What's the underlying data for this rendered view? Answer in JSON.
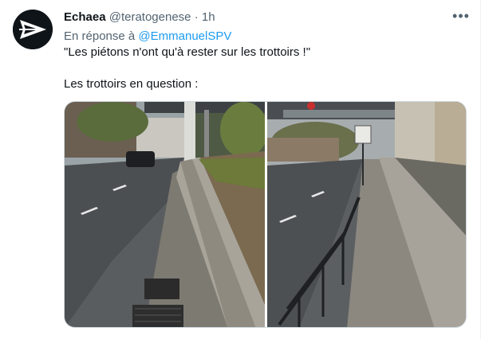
{
  "tweet": {
    "author_name": "Echaea",
    "author_handle": "@teratogenese",
    "separator": "·",
    "time": "1h",
    "more_label": "•••",
    "reply_prefix": "En réponse à",
    "reply_mention": "@EmmanuelSPV",
    "text_line1": "\"Les piétons n'ont qu'à rester sur les trottoirs !\"",
    "text_line2": "Les trottoirs en question :"
  },
  "icons": {
    "avatar": "arrow-logo-icon",
    "more": "more-horizontal-icon"
  },
  "colors": {
    "text": "#0f1419",
    "secondary": "#536471",
    "link": "#1d9bf0"
  }
}
